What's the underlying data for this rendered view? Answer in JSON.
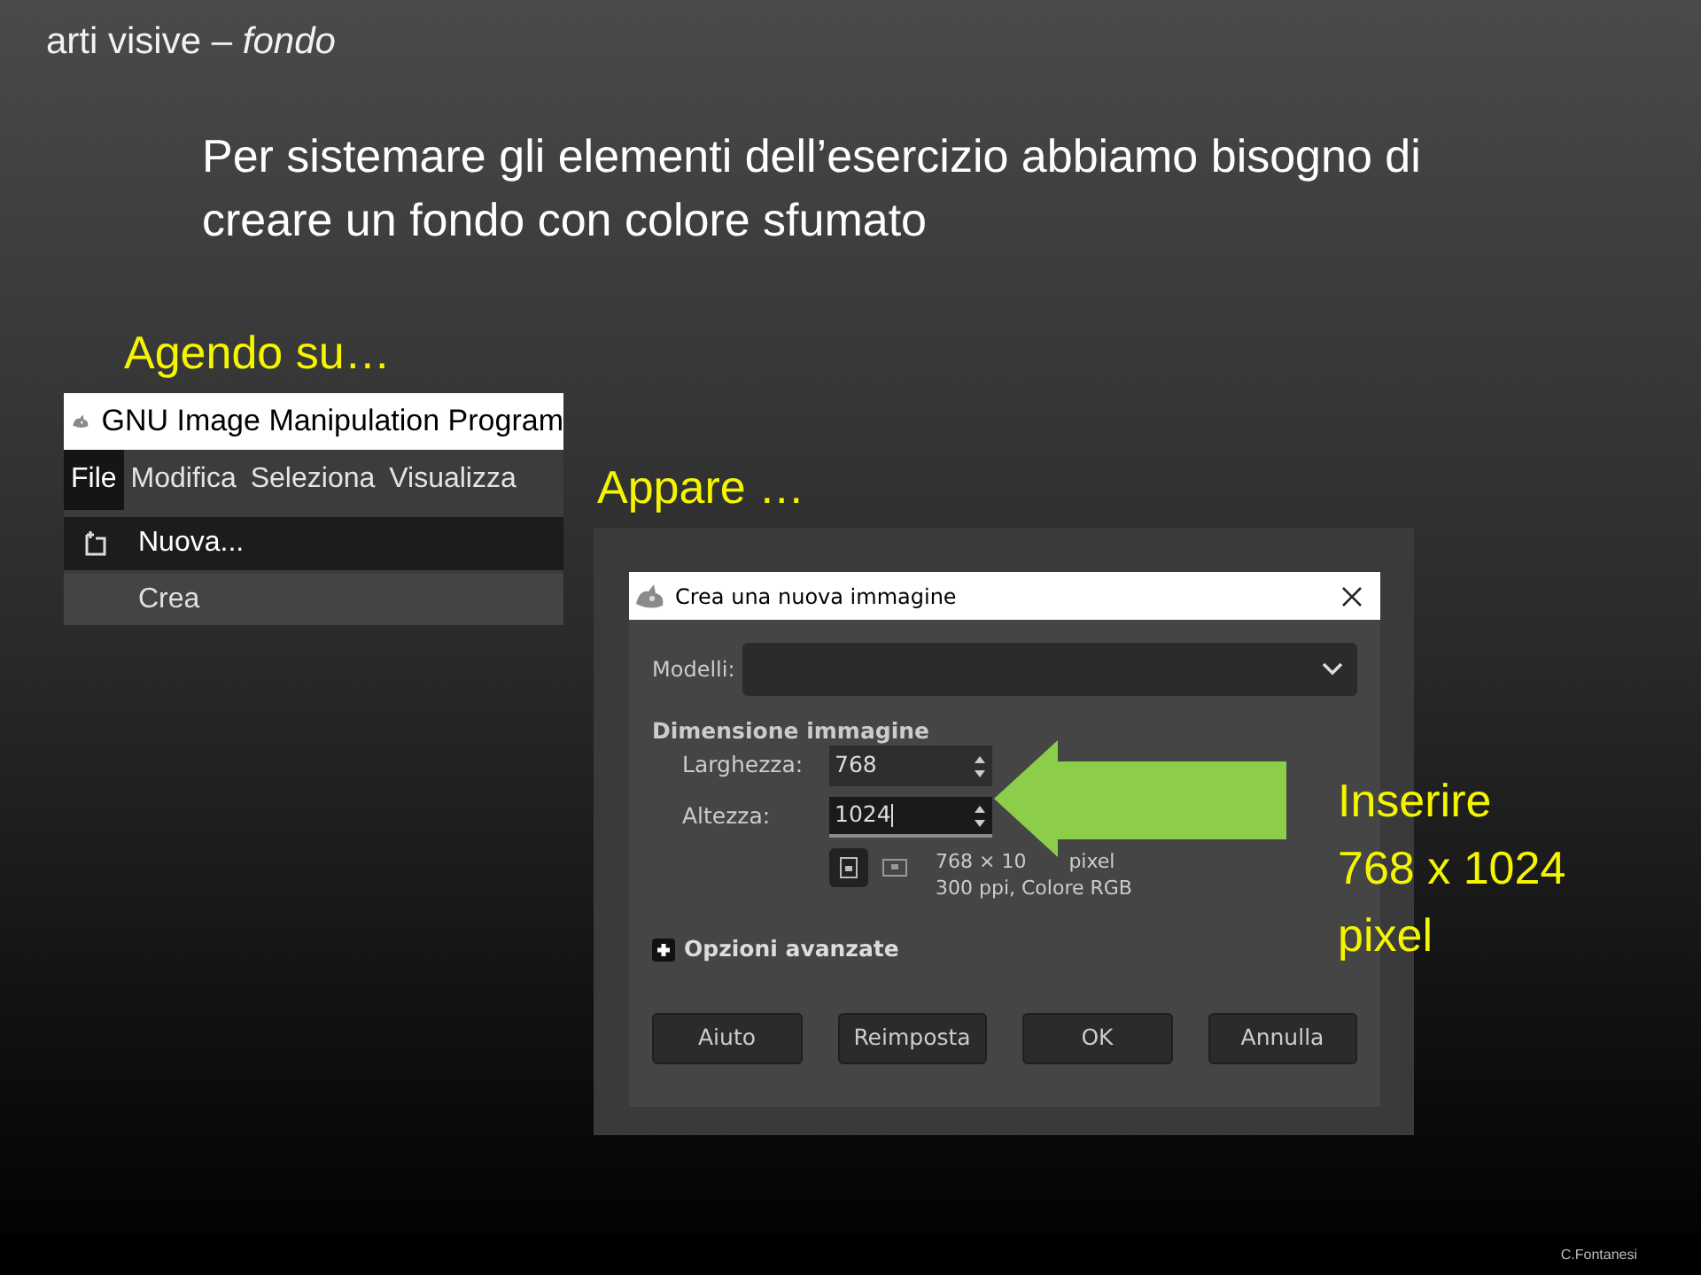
{
  "slide_title": "arti visive – *fondo*",
  "intro": "Per sistemare gli elementi dell’esercizio abbiamo bisogno di creare un fondo con colore sfumato",
  "step_1": "Agendo su…",
  "gimp_menu": {
    "window_title": "GNU Image Manipulation Program",
    "menus": [
      {
        "label": "File",
        "selected": true
      },
      {
        "label": "Modifica",
        "selected": false
      },
      {
        "label": "Seleziona",
        "selected": false
      },
      {
        "label": "Visualizza",
        "selected": false
      }
    ],
    "items": [
      {
        "label": "Nuova...",
        "kind": "icon",
        "selected": true
      },
      {
        "label": "Crea",
        "kind": "plain",
        "selected": false
      }
    ]
  },
  "step_2": "Appare …",
  "dialog": {
    "title": "Crea una nuova immagine",
    "template_label": "Modelli:",
    "section": "Dimensione immagine",
    "fields": [
      {
        "label": "Larghezza:",
        "value": "768",
        "focused": false
      },
      {
        "label": "Altezza:",
        "value": "1024",
        "focused": true
      }
    ],
    "orientations": [
      {
        "kind": "portrait",
        "selected": true
      },
      {
        "kind": "landscape",
        "selected": false
      }
    ],
    "size_info": [
      "768 × 10",
      "pixel"
    ],
    "resolution_info": "300 ppi, Colore RGB",
    "advanced": {
      "label": "Opzioni avanzate",
      "expanded": false
    },
    "buttons": [
      "Aiuto",
      "Reimposta",
      "OK",
      "Annulla"
    ]
  },
  "callout": [
    "Inserire",
    "768 x 1024",
    "pixel"
  ],
  "footer": "C.Fontanesi"
}
